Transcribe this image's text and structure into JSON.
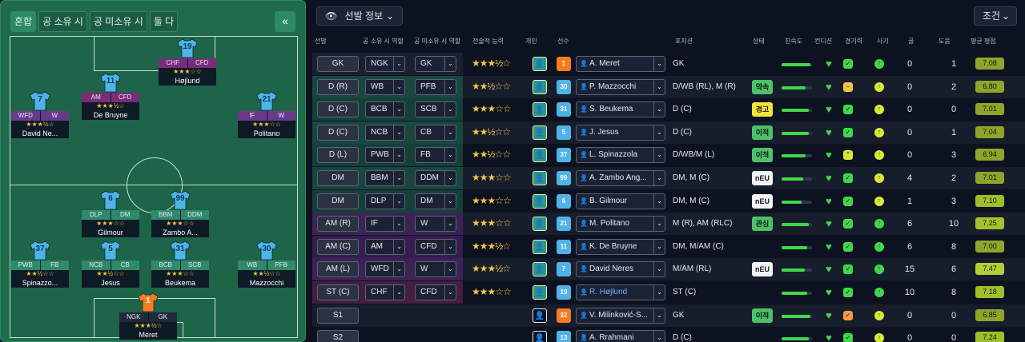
{
  "pitch_tabs": [
    "혼합",
    "공 소유 시",
    "공 미소유 시",
    "둘 다"
  ],
  "collapse_label": "«",
  "pitch_players": [
    {
      "num": "19",
      "r1": "CHF",
      "r2": "CFD",
      "stars": "★★★☆☆",
      "name": "Højlund"
    },
    {
      "num": "11",
      "r1": "AM",
      "r2": "CFD",
      "stars": "★★★½☆",
      "name": "De Bruyne"
    },
    {
      "num": "7",
      "r1": "WFD",
      "r2": "W",
      "stars": "★★★½☆",
      "name": "David Ne..."
    },
    {
      "num": "21",
      "r1": "IF",
      "r2": "W",
      "stars": "★★★☆☆",
      "name": "Politano"
    },
    {
      "num": "6",
      "r1": "DLP",
      "r2": "DM",
      "stars": "★★★☆☆",
      "name": "Gilmour"
    },
    {
      "num": "99",
      "r1": "BBM",
      "r2": "DDM",
      "stars": "★★★☆☆",
      "name": "Zambo A..."
    },
    {
      "num": "37",
      "r1": "PWB",
      "r2": "FB",
      "stars": "★★½☆☆",
      "name": "Spinazzo..."
    },
    {
      "num": "5",
      "r1": "NCB",
      "r2": "CB",
      "stars": "★★½☆☆",
      "name": "Jesus"
    },
    {
      "num": "31",
      "r1": "BCB",
      "r2": "SCB",
      "stars": "★★★☆☆",
      "name": "Beukema"
    },
    {
      "num": "30",
      "r1": "WB",
      "r2": "PFB",
      "stars": "★★½☆☆",
      "name": "Mazzocchi"
    },
    {
      "num": "1",
      "r1": "NGK",
      "r2": "GK",
      "stars": "★★★½☆",
      "name": "Meret"
    }
  ],
  "view_select": "선발 정보",
  "filter_label": "조건",
  "headers": [
    "선발",
    "공 소유 시 역할",
    "공 미소유 시 역할",
    "전술적 능력",
    "개인",
    "선수",
    "포지션",
    "상태",
    "친숙도",
    "컨디션",
    "경기력",
    "사기",
    "골",
    "도움",
    "평균 평점"
  ],
  "rows": [
    {
      "pos": "GK",
      "r1": "NGK",
      "r2": "GK",
      "stars": "★★★½☆",
      "num": "1",
      "name": "A. Meret",
      "positions": "GK",
      "tag": "",
      "fam": 0.95,
      "goals": "0",
      "assists": "1",
      "rating": "7.08"
    },
    {
      "pos": "D (R)",
      "r1": "WB",
      "r2": "PFB",
      "stars": "★★½☆☆",
      "num": "30",
      "name": "P. Mazzocchi",
      "positions": "D/WB (RL), M (R)",
      "tag": "약속",
      "fam": 0.8,
      "goals": "0",
      "assists": "2",
      "rating": "6.80"
    },
    {
      "pos": "D (C)",
      "r1": "BCB",
      "r2": "SCB",
      "stars": "★★★☆☆",
      "num": "31",
      "name": "S. Beukema",
      "positions": "D (C)",
      "tag": "경고",
      "fam": 0.9,
      "goals": "0",
      "assists": "0",
      "rating": "7.01"
    },
    {
      "pos": "D (C)",
      "r1": "NCB",
      "r2": "CB",
      "stars": "★★½☆☆",
      "num": "5",
      "name": "J. Jesus",
      "positions": "D (C)",
      "tag": "이적",
      "fam": 0.9,
      "goals": "0",
      "assists": "1",
      "rating": "7.04"
    },
    {
      "pos": "D (L)",
      "r1": "PWB",
      "r2": "FB",
      "stars": "★★½☆☆",
      "num": "37",
      "name": "L. Spinazzola",
      "positions": "D/WB/M (L)",
      "tag": "이적",
      "fam": 0.8,
      "goals": "0",
      "assists": "3",
      "rating": "6.94"
    },
    {
      "pos": "DM",
      "r1": "BBM",
      "r2": "DDM",
      "stars": "★★★☆☆",
      "num": "99",
      "name": "A. Zambo Ang...",
      "positions": "DM, M (C)",
      "tag": "nEU",
      "fam": 0.7,
      "goals": "4",
      "assists": "2",
      "rating": "7.01"
    },
    {
      "pos": "DM",
      "r1": "DLP",
      "r2": "DM",
      "stars": "★★★☆☆",
      "num": "6",
      "name": "B. Gilmour",
      "positions": "DM, M (C)",
      "tag": "nEU",
      "fam": 0.65,
      "goals": "1",
      "assists": "3",
      "rating": "7.10"
    },
    {
      "pos": "AM (R)",
      "r1": "IF",
      "r2": "W",
      "stars": "★★★☆☆",
      "num": "21",
      "name": "M. Politano",
      "positions": "M (R), AM (RLC)",
      "tag": "관심",
      "fam": 0.9,
      "goals": "6",
      "assists": "10",
      "rating": "7.25"
    },
    {
      "pos": "AM (C)",
      "r1": "AM",
      "r2": "CFD",
      "stars": "★★★½☆",
      "num": "11",
      "name": "K. De Bruyne",
      "positions": "DM, M/AM (C)",
      "tag": "",
      "fam": 0.85,
      "goals": "6",
      "assists": "8",
      "rating": "7.00"
    },
    {
      "pos": "AM (L)",
      "r1": "WFD",
      "r2": "W",
      "stars": "★★★½☆",
      "num": "7",
      "name": "David Neres",
      "positions": "M/AM (RL)",
      "tag": "nEU",
      "fam": 0.75,
      "goals": "15",
      "assists": "6",
      "rating": "7.47"
    },
    {
      "pos": "ST (C)",
      "r1": "CHF",
      "r2": "CFD",
      "stars": "★★★☆☆",
      "num": "19",
      "name": "R. Højlund",
      "positions": "ST (C)",
      "tag": "",
      "fam": 0.85,
      "goals": "10",
      "assists": "8",
      "rating": "7.18"
    },
    {
      "pos": "S1",
      "r1": "",
      "r2": "",
      "stars": "",
      "num": "32",
      "name": "V. Milinković-S...",
      "positions": "GK",
      "tag": "이적",
      "fam": 0.95,
      "goals": "0",
      "assists": "0",
      "rating": "6.85"
    },
    {
      "pos": "S2",
      "r1": "",
      "r2": "",
      "stars": "",
      "num": "13",
      "name": "A. Rrahmani",
      "positions": "D (C)",
      "tag": "",
      "fam": 0.9,
      "goals": "0",
      "assists": "0",
      "rating": "7.24"
    }
  ]
}
